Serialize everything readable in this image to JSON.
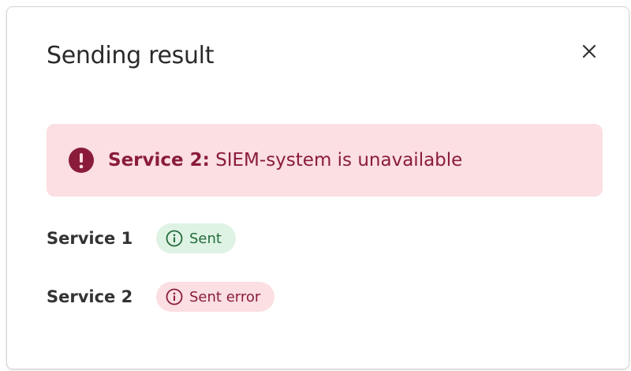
{
  "dialog": {
    "title": "Sending result",
    "close_icon": "close-icon"
  },
  "alert": {
    "icon": "exclamation-circle-icon",
    "service": "Service 2:",
    "message": " SIEM-system is unavailable",
    "color": "#8a1c3a",
    "background": "#fbdfe2"
  },
  "services": [
    {
      "label": "Service 1",
      "status": "Sent",
      "status_type": "success",
      "icon": "info-circle-icon",
      "color": "#236b3a",
      "background": "#dff3e4"
    },
    {
      "label": "Service 2",
      "status": "Sent error",
      "status_type": "error",
      "icon": "info-circle-icon",
      "color": "#8a1c3a",
      "background": "#fbdfe2"
    }
  ]
}
